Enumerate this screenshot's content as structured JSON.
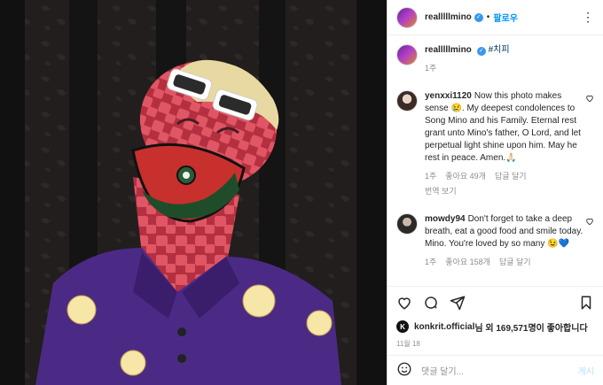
{
  "header": {
    "username": "realllllmino",
    "follow": "팔로우",
    "more": "⋮",
    "dot": "•"
  },
  "caption": {
    "username": "realllllmino",
    "text": "#치피",
    "time": "1주"
  },
  "comments": [
    {
      "username": "yenxxi1120",
      "text": "Now this photo makes sense 😢. My deepest condolences to Song Mino and his Family. Eternal rest grant unto Mino's father, O Lord, and let perpetual light shine upon him. May he rest in peace. Amen.🙏🏻",
      "time": "1주",
      "likes": "좋아요 49개",
      "reply": "답글 달기",
      "translate": "번역 보기"
    },
    {
      "username": "mowdy94",
      "text": "Don't forget to take a deep breath, eat a good food and smile today. Mino. You're loved by so many 😉💙",
      "time": "1주",
      "likes": "좋아요 158개",
      "reply": "답글 달기"
    }
  ],
  "likes_line": {
    "badge": "K",
    "account": "konkrit.official",
    "rest": "님 외 169,571명이 좋아합니다"
  },
  "date": "11월 18",
  "add_comment": {
    "placeholder": "댓글 달기...",
    "post": "게시"
  },
  "colors": {
    "accent": "#0095f6",
    "media_bg": "#1a1716",
    "character": "#d4495a",
    "jacket": "#4b2a86"
  },
  "icons": [
    "heart-icon",
    "comment-icon",
    "share-icon",
    "bookmark-icon",
    "emoji-icon",
    "more-icon",
    "verified-icon"
  ]
}
